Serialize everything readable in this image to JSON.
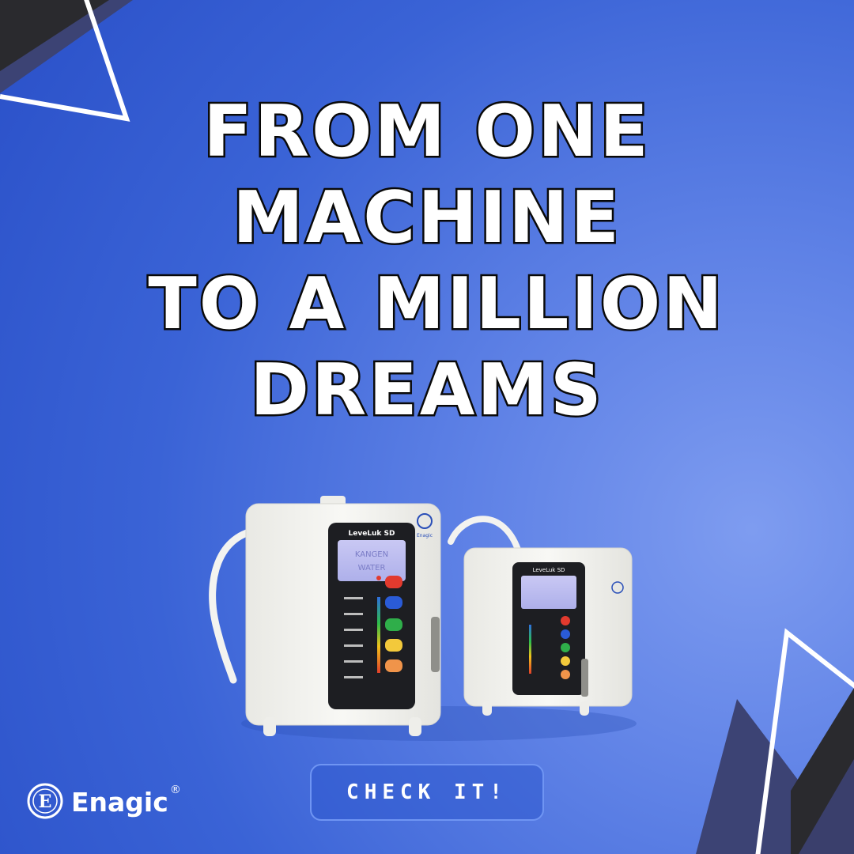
{
  "headline": {
    "line1": "FROM ONE",
    "line2": "MACHINE",
    "line3": "TO A MILLION",
    "line4": "DREAMS"
  },
  "cta": {
    "label": "CHECK IT!"
  },
  "brand": {
    "name": "Enagic",
    "registered": "®",
    "logo_glyph": "E"
  },
  "product": {
    "large_model": "LeveLuk SD",
    "large_display_line1": "KANGEN",
    "large_display_line2": "WATER",
    "small_model": "LeveLuk SD",
    "panel_brand": "Enagic"
  },
  "colors": {
    "background_main": "#3a63d6",
    "background_light": "#7e9cf0",
    "decor_dark": "#3c4374",
    "decor_black": "#2a2a2e",
    "headline_fill": "#ffffff",
    "headline_stroke": "#0b0b0b",
    "cta_border": "#6f95f3"
  }
}
